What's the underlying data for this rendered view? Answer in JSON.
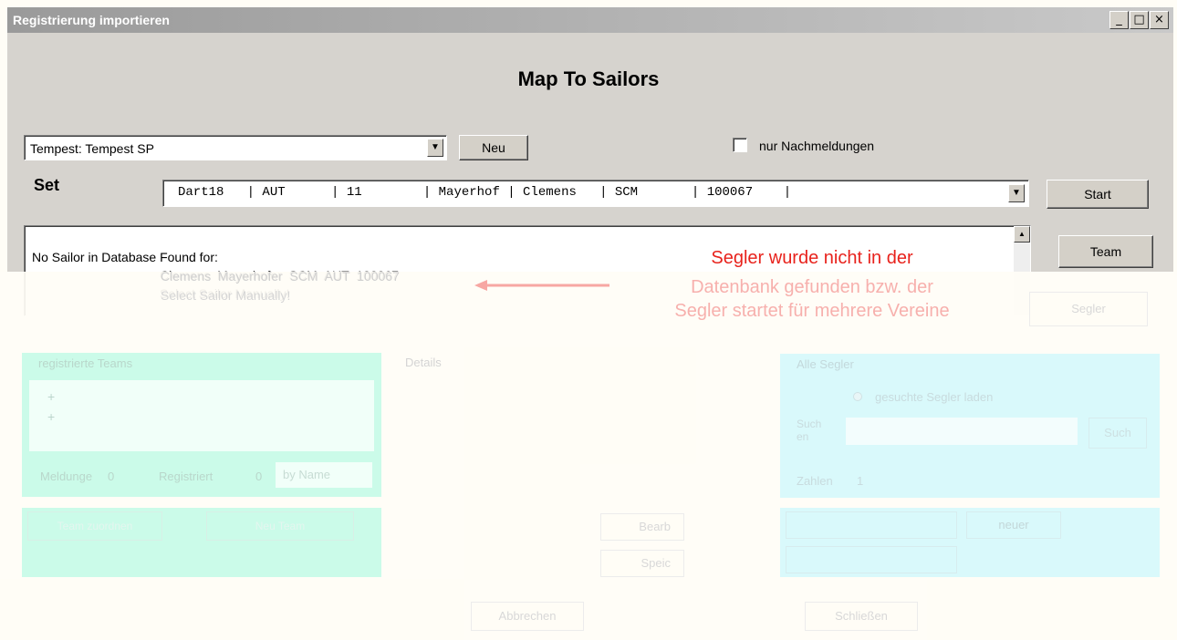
{
  "window": {
    "title": "Registrierung importieren",
    "heading": "Map To Sailors"
  },
  "class_select": {
    "value": "Tempest:  Tempest SP"
  },
  "new_button": "Neu",
  "late_only": {
    "label": "nur Nachmeldungen",
    "checked": false
  },
  "set": {
    "label": "Set",
    "value": "Dart18   | AUT      | 11        | Mayerhof | Clemens   | SCM       | 100067    |"
  },
  "start_button": "Start",
  "team_button": "Team",
  "sailor_button": "Segler",
  "message": {
    "line1": "No Sailor in Database Found for:",
    "line2": "Clemens  Mayerhofer  SCM  AUT  100067",
    "line3": "Select Sailor Manually!"
  },
  "annotation": {
    "line1": "Segler wurde nicht in der",
    "line2": "Datenbank gefunden bzw.  der",
    "line3": "Segler startet für mehrere Vereine",
    "arrow": "←"
  },
  "registered_teams": {
    "label": "registrierte Teams",
    "items": [
      "+",
      "+"
    ],
    "entries_label": "Meldunge",
    "entries_count": "0",
    "registered_label": "Registriert",
    "registered_count": "0",
    "sort": "by Name",
    "action1": "Team zuordnen",
    "action2": "Neu Team"
  },
  "details": {
    "label": "Details",
    "edit_button": "Bearb",
    "save_button": "Speic"
  },
  "all_sailors": {
    "label": "Alle Segler",
    "radio_label": "gesuchte Segler laden",
    "search_label": "Such\nen",
    "search_value": "",
    "search_button": "Such",
    "count_label": "Zahlen",
    "count_value": "1",
    "new_button": "neuer"
  },
  "footer": {
    "cancel_button": "Abbrechen",
    "close_button": "Schließen"
  },
  "colors": {
    "annotation_red": "#e8221c",
    "teal_panel": "#cbfbe9",
    "cyan_panel": "#d9f9fb",
    "titlebar": "#a8a8a8"
  }
}
